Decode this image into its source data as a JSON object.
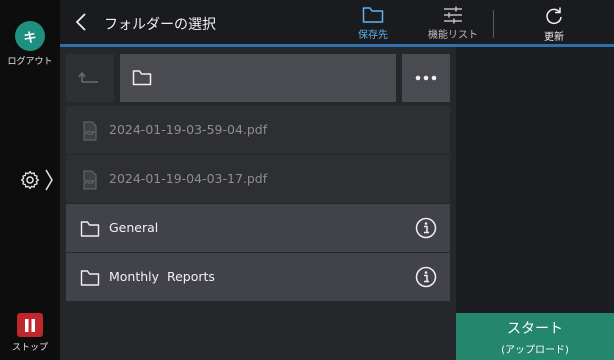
{
  "sidebar": {
    "avatar_letter": "キ",
    "logout_label": "ログアウト",
    "stop_label": "ストップ"
  },
  "header": {
    "title": "フォルダーの選択",
    "tabs": {
      "save": "保存先",
      "functions": "機能リスト",
      "refresh": "更新"
    }
  },
  "files": [
    {
      "name": "2024-01-19-03-59-04.pdf",
      "type": "pdf-icon"
    },
    {
      "name": "2024-01-19-04-03-17.pdf",
      "type": "pdf-icon"
    }
  ],
  "folders": [
    {
      "name": "General",
      "type": "folder-icon"
    },
    {
      "name": "Monthly  Reports",
      "type": "folder-icon"
    }
  ],
  "start": {
    "label": "スタート",
    "sublabel": "(アップロード)"
  },
  "colors": {
    "accent": "#2e6fb0",
    "start": "#25866e",
    "stop": "#c0272d",
    "avatar": "#1f8f80"
  }
}
